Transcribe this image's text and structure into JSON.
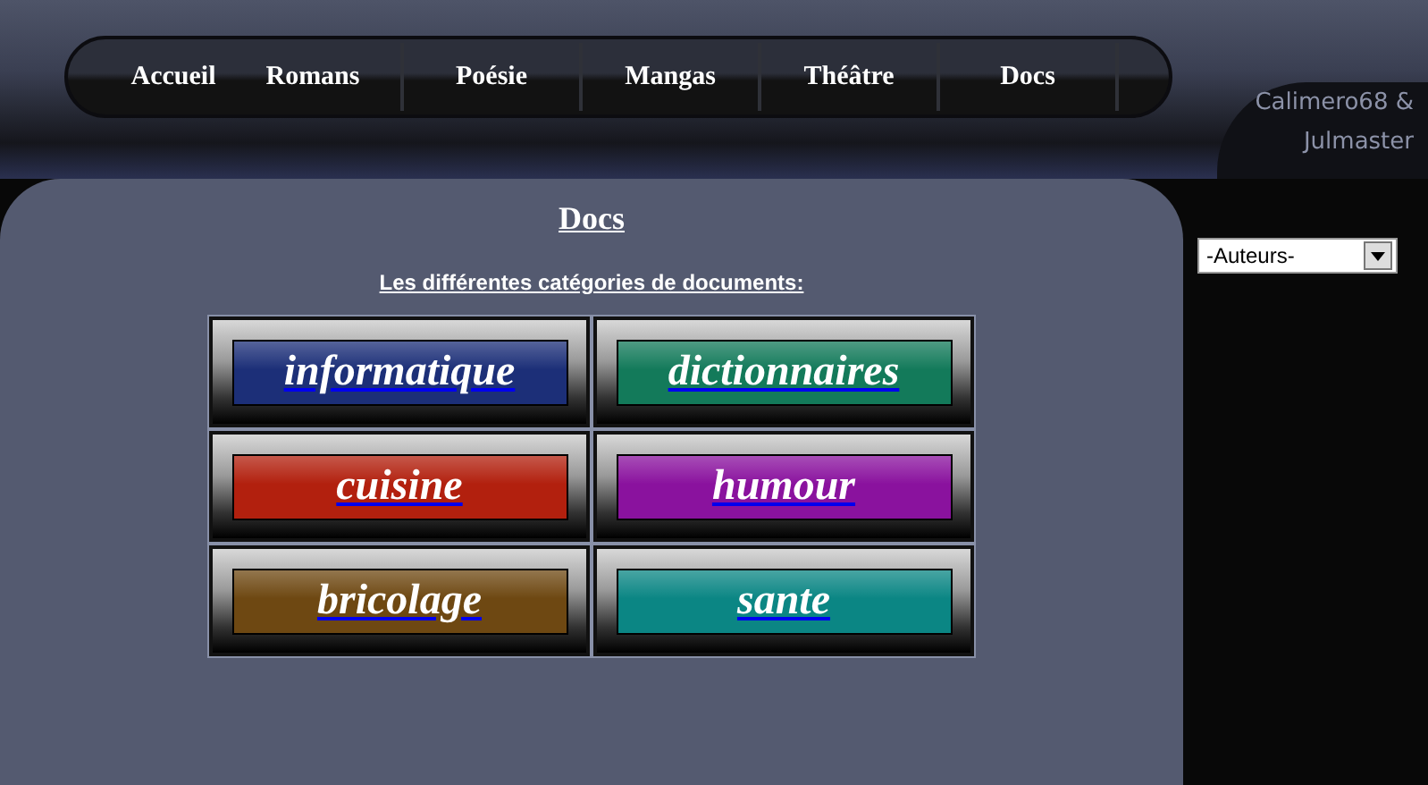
{
  "nav": {
    "items": [
      {
        "label": "Accueil"
      },
      {
        "label": "Romans"
      },
      {
        "label": "Poésie"
      },
      {
        "label": "Mangas"
      },
      {
        "label": "Théâtre"
      },
      {
        "label": "Docs"
      }
    ]
  },
  "credits": {
    "line_1": "Calimero68 &",
    "line_2": "Julmaster"
  },
  "content": {
    "title": "Docs",
    "subtitle": "Les différentes catégories de documents:",
    "categories": [
      {
        "label": "informatique",
        "color": "#1c2f78"
      },
      {
        "label": "dictionnaires",
        "color": "#137a5a"
      },
      {
        "label": "cuisine",
        "color": "#b2200e"
      },
      {
        "label": "humour",
        "color": "#8a129e"
      },
      {
        "label": "bricolage",
        "color": "#6e4812"
      },
      {
        "label": "sante",
        "color": "#0b8684"
      }
    ]
  },
  "authors_select": {
    "value": "-Auteurs-"
  }
}
